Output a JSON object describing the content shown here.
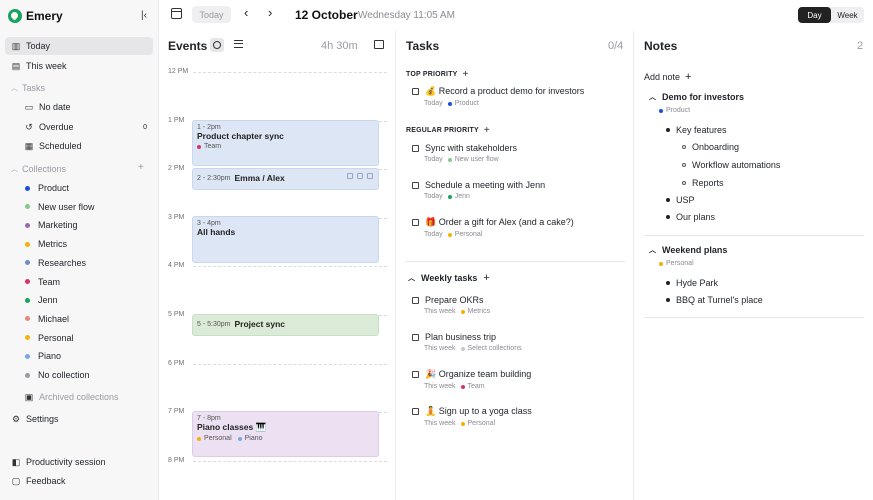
{
  "app": {
    "name": "Emery"
  },
  "sidebar": {
    "nav": [
      {
        "label": "Today",
        "icon": "columns-icon",
        "active": true
      },
      {
        "label": "This week",
        "icon": "week-icon",
        "active": false
      }
    ],
    "tasks_section": {
      "label": "Tasks",
      "items": [
        {
          "label": "No date",
          "icon": "inbox-icon",
          "count": ""
        },
        {
          "label": "Overdue",
          "icon": "history-icon",
          "count": "0"
        },
        {
          "label": "Scheduled",
          "icon": "calendar-check-icon",
          "count": ""
        }
      ]
    },
    "collections_section": {
      "label": "Collections",
      "items": [
        {
          "label": "Product",
          "color": "#1d4ed8"
        },
        {
          "label": "New user flow",
          "color": "#86c98a"
        },
        {
          "label": "Marketing",
          "color": "#9b6bb0"
        },
        {
          "label": "Metrics",
          "color": "#f2b400"
        },
        {
          "label": "Researches",
          "color": "#6c8fc4"
        },
        {
          "label": "Team",
          "color": "#d6336c"
        },
        {
          "label": "Jenn",
          "color": "#19a35b"
        },
        {
          "label": "Michael",
          "color": "#e58a7a"
        },
        {
          "label": "Personal",
          "color": "#f2b400"
        },
        {
          "label": "Piano",
          "color": "#7aa7e0"
        },
        {
          "label": "No collection",
          "color": "#9a9aa2"
        }
      ],
      "archived_label": "Archived collections"
    },
    "settings_label": "Settings",
    "footer": [
      {
        "label": "Productivity session"
      },
      {
        "label": "Feedback"
      }
    ]
  },
  "topbar": {
    "today_label": "Today",
    "prev_arrow": "‹",
    "next_arrow": "›",
    "date_main": "12 October",
    "date_sub": "Wednesday 11:05 AM",
    "view_day": "Day",
    "view_week": "Week"
  },
  "events": {
    "title": "Events",
    "total": "4h 30m",
    "hours": [
      "12 PM",
      "1 PM",
      "2 PM",
      "3 PM",
      "4 PM",
      "5 PM",
      "6 PM",
      "7 PM",
      "8 PM"
    ],
    "items": [
      {
        "time": "1 - 2pm",
        "name": "Product chapter sync",
        "tag": "Team",
        "tag_color": "#d6336c"
      },
      {
        "time": "2 - 2:30pm",
        "name": "Emma / Alex"
      },
      {
        "time": "3 - 4pm",
        "name": "All hands"
      },
      {
        "time": "5 - 5:30pm",
        "name": "Project sync"
      },
      {
        "time": "7 - 8pm",
        "name": "Piano classes 🎹",
        "tags": [
          {
            "label": "Personal",
            "color": "#f2b400"
          },
          {
            "label": "Piano",
            "color": "#7aa7e0"
          }
        ]
      }
    ]
  },
  "tasks": {
    "title": "Tasks",
    "counter": "0/4",
    "top_priority": {
      "label": "TOP PRIORITY",
      "items": [
        {
          "title": "💰 Record a product demo for investors",
          "when": "Today",
          "tag": "Product",
          "tag_color": "#1d4ed8"
        }
      ]
    },
    "regular_priority": {
      "label": "REGULAR PRIORITY",
      "items": [
        {
          "title": "Sync with stakeholders",
          "when": "Today",
          "tag": "New user flow",
          "tag_color": "#86c98a"
        },
        {
          "title": "Schedule a meeting with Jenn",
          "when": "Today",
          "tag": "Jenn",
          "tag_color": "#19a35b"
        },
        {
          "title": "🎁 Order a gift for Alex (and a cake?)",
          "when": "Today",
          "tag": "Personal",
          "tag_color": "#f2b400"
        }
      ]
    },
    "weekly": {
      "label": "Weekly tasks",
      "items": [
        {
          "title": "Prepare OKRs",
          "when": "This week",
          "tag": "Metrics",
          "tag_color": "#f2b400"
        },
        {
          "title": "Plan business trip",
          "when": "This week",
          "tag": "Select collections",
          "tag_color": "#c8c8cc"
        },
        {
          "title": "🎉 Organize team building",
          "when": "This week",
          "tag": "Team",
          "tag_color": "#d6336c"
        },
        {
          "title": "🧘 Sign up to a yoga class",
          "when": "This week",
          "tag": "Personal",
          "tag_color": "#f2b400"
        }
      ]
    }
  },
  "notes": {
    "title": "Notes",
    "counter": "2",
    "add_label": "Add note",
    "note1": {
      "title": "Demo for investors",
      "tag": "Product",
      "tag_color": "#1d4ed8",
      "bullets": [
        "Key features",
        "Onboarding",
        "Workflow automations",
        "Reports",
        "USP",
        "Our plans"
      ]
    },
    "note2": {
      "title": "Weekend plans",
      "tag": "Personal",
      "tag_color": "#f2b400",
      "bullets": [
        "Hyde Park",
        "BBQ at Turnel's place"
      ]
    }
  }
}
